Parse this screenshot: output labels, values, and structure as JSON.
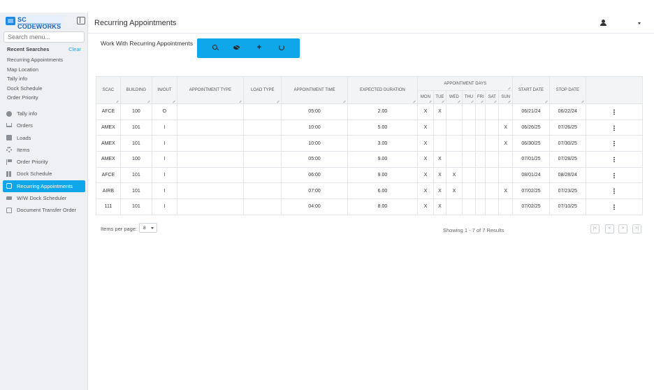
{
  "brand": {
    "name": "SC CODEWORKS"
  },
  "sidebar": {
    "search_placeholder": "Search menu...",
    "recent_title": "Recent Searches",
    "clear_label": "Clear",
    "recent": [
      "Recurring Appointments",
      "Map Location",
      "Tally info",
      "Dock Schedule",
      "Order Priority"
    ],
    "nav": [
      {
        "label": "Tally info",
        "icon": "info-icon"
      },
      {
        "label": "Orders",
        "icon": "cart-icon"
      },
      {
        "label": "Loads",
        "icon": "package-icon"
      },
      {
        "label": "Items",
        "icon": "gear-icon"
      },
      {
        "label": "Order Priority",
        "icon": "flag-icon"
      },
      {
        "label": "Dock Schedule",
        "icon": "dock-icon"
      },
      {
        "label": "Recurring Appointments",
        "icon": "calendar-icon",
        "active": true
      },
      {
        "label": "W/W Dock Scheduler",
        "icon": "truck-icon"
      },
      {
        "label": "Document Transfer Order",
        "icon": "document-icon"
      }
    ]
  },
  "header": {
    "title": "Recurring Appointments"
  },
  "main": {
    "section_title": "Work With Recurring Appointments",
    "toolbar": {
      "search": "search-icon",
      "hide": "eye-off-icon",
      "add": "+",
      "refresh": "refresh-icon"
    }
  },
  "table": {
    "columns": [
      "SCAC",
      "BUILDING",
      "IN/OUT",
      "APPOINTMENT TYPE",
      "LOAD TYPE",
      "APPOINTMENT TIME",
      "EXPECTED DURATION"
    ],
    "days_group": "APPOINTMENT DAYS",
    "days": [
      "MON",
      "TUE",
      "WED",
      "THU",
      "FRI",
      "SAT",
      "SUN"
    ],
    "tail_columns": [
      "START DATE",
      "STOP DATE"
    ],
    "rows": [
      {
        "scac": "AFCE",
        "building": "100",
        "inout": "O",
        "type": "",
        "load": "",
        "time": "05:00",
        "duration": "2.00",
        "days": [
          "X",
          "X",
          "",
          "",
          "",
          "",
          ""
        ],
        "start": "06/21/24",
        "stop": "06/22/24"
      },
      {
        "scac": "AMEX",
        "building": "101",
        "inout": "I",
        "type": "",
        "load": "",
        "time": "10:00",
        "duration": "5.00",
        "days": [
          "X",
          "",
          "",
          "",
          "",
          "",
          "X"
        ],
        "start": "06/26/25",
        "stop": "07/26/25"
      },
      {
        "scac": "AMEX",
        "building": "101",
        "inout": "I",
        "type": "",
        "load": "",
        "time": "10:00",
        "duration": "3.00",
        "days": [
          "X",
          "",
          "",
          "",
          "",
          "",
          "X"
        ],
        "start": "06/30/25",
        "stop": "07/30/25"
      },
      {
        "scac": "AMEX",
        "building": "100",
        "inout": "I",
        "type": "",
        "load": "",
        "time": "05:00",
        "duration": "9.00",
        "days": [
          "X",
          "X",
          "",
          "",
          "",
          "",
          ""
        ],
        "start": "07/01/25",
        "stop": "07/28/25"
      },
      {
        "scac": "AFCE",
        "building": "101",
        "inout": "I",
        "type": "",
        "load": "",
        "time": "06:00",
        "duration": "9.00",
        "days": [
          "X",
          "X",
          "X",
          "",
          "",
          "",
          ""
        ],
        "start": "08/01/24",
        "stop": "08/28/24"
      },
      {
        "scac": "AIRB",
        "building": "101",
        "inout": "I",
        "type": "",
        "load": "",
        "time": "07:00",
        "duration": "6.00",
        "days": [
          "X",
          "X",
          "X",
          "",
          "",
          "",
          "X"
        ],
        "start": "07/02/25",
        "stop": "07/23/25"
      },
      {
        "scac": "111",
        "building": "101",
        "inout": "I",
        "type": "",
        "load": "",
        "time": "04:00",
        "duration": "8.00",
        "days": [
          "X",
          "X",
          "",
          "",
          "",
          "",
          ""
        ],
        "start": "07/02/25",
        "stop": "07/10/25"
      }
    ]
  },
  "pagination": {
    "items_per_page_label": "Items per page:",
    "items_per_page": "8",
    "showing": "Showing 1 - 7 of 7  Results",
    "first": "|<",
    "prev": "<",
    "next": ">",
    "last": ">|"
  }
}
